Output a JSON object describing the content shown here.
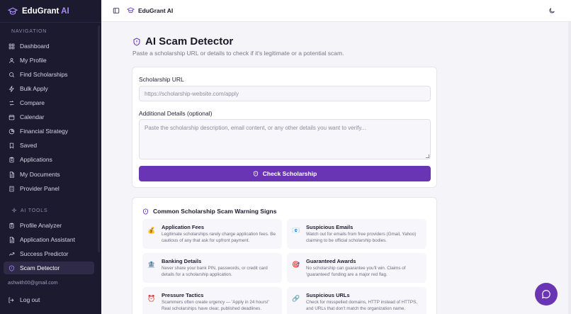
{
  "sidebar": {
    "brand_name": "EduGrant",
    "brand_ai": " AI",
    "nav_label": "NAVIGATION",
    "ai_tools_label": "AI TOOLS",
    "nav_items": [
      {
        "label": "Dashboard",
        "icon": "grid-icon"
      },
      {
        "label": "My Profile",
        "icon": "user-icon"
      },
      {
        "label": "Find Scholarships",
        "icon": "search-icon"
      },
      {
        "label": "Bulk Apply",
        "icon": "lightning-icon"
      },
      {
        "label": "Compare",
        "icon": "compare-icon"
      },
      {
        "label": "Calendar",
        "icon": "calendar-icon"
      },
      {
        "label": "Financial Strategy",
        "icon": "pie-chart-icon"
      },
      {
        "label": "Saved",
        "icon": "bookmark-icon"
      },
      {
        "label": "Applications",
        "icon": "clipboard-icon"
      },
      {
        "label": "My Documents",
        "icon": "document-icon"
      },
      {
        "label": "Provider Panel",
        "icon": "building-icon"
      }
    ],
    "ai_items": [
      {
        "label": "Profile Analyzer",
        "icon": "clipboard-icon"
      },
      {
        "label": "Application Assistant",
        "icon": "document-icon"
      },
      {
        "label": "Success Predictor",
        "icon": "trend-icon"
      },
      {
        "label": "Scam Detector",
        "icon": "shield-icon",
        "active": true
      }
    ],
    "email": "ashwith00@gmail.com",
    "logout": "Log out"
  },
  "topbar": {
    "brand": "EduGrant AI"
  },
  "page": {
    "title": "AI Scam Detector",
    "subtitle": "Paste a scholarship URL or details to check if it's legitimate or a potential scam."
  },
  "form": {
    "url_label": "Scholarship URL",
    "url_placeholder": "https://scholarship-website.com/apply",
    "details_label": "Additional Details (optional)",
    "details_placeholder": "Paste the scholarship description, email content, or any other details you want to verify...",
    "submit_label": "Check Scholarship"
  },
  "warnings": {
    "title": "Common Scholarship Scam Warning Signs",
    "items": [
      {
        "title": "Application Fees",
        "icon": "money-bag-icon",
        "emoji": "💰",
        "desc": "Legitimate scholarships rarely charge application fees. Be cautious of any that ask for upfront payment."
      },
      {
        "title": "Suspicious Emails",
        "icon": "email-icon",
        "emoji": "📧",
        "desc": "Watch out for emails from free providers (Gmail, Yahoo) claiming to be official scholarship bodies."
      },
      {
        "title": "Banking Details",
        "icon": "bank-icon",
        "emoji": "🏦",
        "desc": "Never share your bank PIN, passwords, or credit card details for a scholarship application."
      },
      {
        "title": "Guaranteed Awards",
        "icon": "target-icon",
        "emoji": "🎯",
        "desc": "No scholarship can guarantee you'll win. Claims of 'guaranteed' funding are a major red flag."
      },
      {
        "title": "Pressure Tactics",
        "icon": "alarm-icon",
        "emoji": "⏰",
        "desc": "Scammers often create urgency — 'Apply in 24 hours!' Real scholarships have clear, published deadlines."
      },
      {
        "title": "Suspicious URLs",
        "icon": "link-icon",
        "emoji": "🔗",
        "desc": "Check for misspelled domains, HTTP instead of HTTPS, and URLs that don't match the organization name."
      }
    ]
  },
  "colors": {
    "sidebar_bg": "#1c1a2e",
    "accent": "#6a35b5"
  }
}
